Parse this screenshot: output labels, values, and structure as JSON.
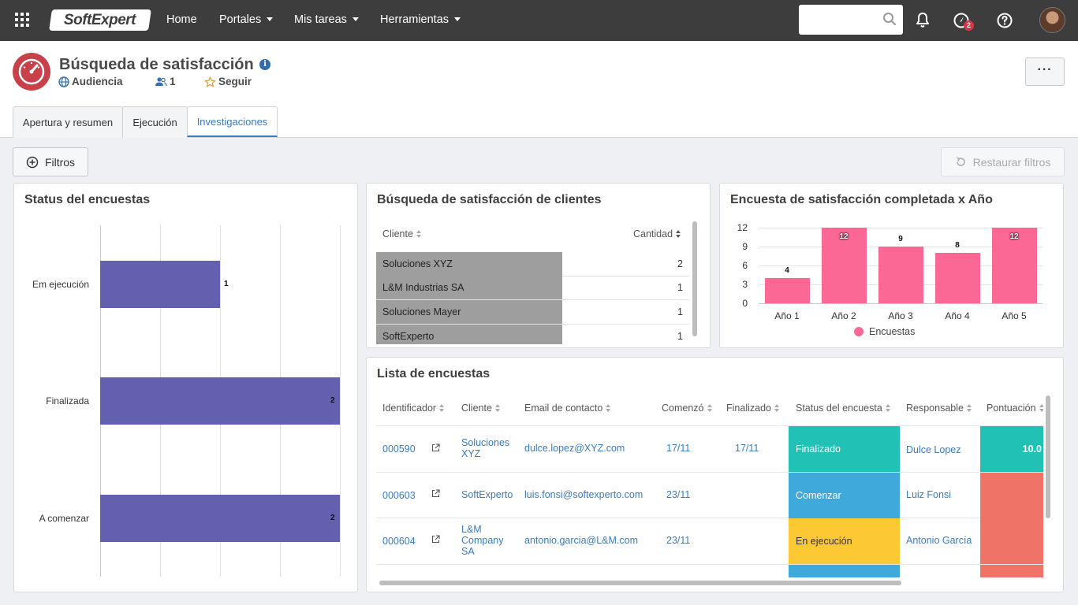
{
  "topbar": {
    "logo_text": "SoftExpert",
    "nav": [
      {
        "label": "Home"
      },
      {
        "label": "Portales"
      },
      {
        "label": "Mis tareas"
      },
      {
        "label": "Herramientas"
      }
    ],
    "search_placeholder": "",
    "notification_badge": "2"
  },
  "header": {
    "title": "Búsqueda de satisfacción",
    "audience_label": "Audiencia",
    "members_count": "1",
    "follow_label": "Seguir",
    "more_label": "···",
    "tabs": [
      {
        "label": "Apertura y resumen"
      },
      {
        "label": "Ejecución"
      },
      {
        "label": "Investigaciones"
      }
    ]
  },
  "toolbar": {
    "filters_label": "Filtros",
    "restore_label": "Restaurar filtros"
  },
  "status_panel": {
    "title": "Status del encuestas"
  },
  "clients_panel": {
    "title": "Búsqueda de satisfacción de clientes",
    "col_client": "Cliente",
    "col_qty": "Cantidad",
    "rows": [
      {
        "client": "Soluciones XYZ",
        "qty": "2"
      },
      {
        "client": "L&M Industrias SA",
        "qty": "1"
      },
      {
        "client": "Soluciones Mayer",
        "qty": "1"
      },
      {
        "client": "SoftExperto",
        "qty": "1"
      }
    ]
  },
  "year_panel": {
    "title": "Encuesta de satisfacción completada x Año",
    "legend": "Encuestas"
  },
  "list_panel": {
    "title": "Lista de encuestas",
    "columns": [
      "Identificador",
      "Cliente",
      "Email de contacto",
      "Comenzó",
      "Finalizado",
      "Status del encuesta",
      "Responsable",
      "Pontuación"
    ],
    "rows": [
      {
        "id": "000590",
        "client": "Soluciones XYZ",
        "email": "dulce.lopez@XYZ.com",
        "start": "17/11",
        "end": "17/11",
        "status": "Finalizado",
        "status_color": "#22c1b6",
        "owner": "Dulce Lopez",
        "score": "10.0",
        "score_color": "#22c1b6"
      },
      {
        "id": "000603",
        "client": "SoftExperto",
        "email": "luis.fonsi@softexperto.com",
        "start": "23/11",
        "end": "",
        "status": "Comenzar",
        "status_color": "#3fa9dc",
        "owner": "Luiz Fonsi",
        "score": "",
        "score_color": "#ef7467"
      },
      {
        "id": "000604",
        "client": "L&M Company SA",
        "email": "antonio.garcia@L&M.com",
        "start": "23/11",
        "end": "",
        "status": "En ejecución",
        "status_color": "#fcc934",
        "owner": "Antonio García",
        "score": "",
        "score_color": "#ef7467"
      }
    ]
  },
  "chart_data": [
    {
      "type": "bar",
      "orientation": "horizontal",
      "title": "Status del encuestas",
      "categories": [
        "Em ejecución",
        "Finalizada",
        "A comenzar"
      ],
      "values": [
        1,
        2,
        2
      ],
      "value_labels": [
        "1",
        "2",
        "2"
      ],
      "xlim": [
        0,
        2
      ],
      "grid": true,
      "colors": [
        "#6460b0"
      ]
    },
    {
      "type": "bar",
      "title": "Encuesta de satisfacción completada x Año",
      "categories": [
        "Año 1",
        "Año 2",
        "Año 3",
        "Año 4",
        "Año 5"
      ],
      "series": [
        {
          "name": "Encuestas",
          "values": [
            4,
            12,
            9,
            8,
            12
          ]
        }
      ],
      "value_labels": [
        "4",
        "12",
        "9",
        "8",
        "12"
      ],
      "yticks": [
        "0",
        "3",
        "6",
        "9",
        "12"
      ],
      "ylim": [
        0,
        12
      ],
      "grid": true,
      "legend": "bottom",
      "colors": [
        "#fb6895"
      ]
    }
  ]
}
